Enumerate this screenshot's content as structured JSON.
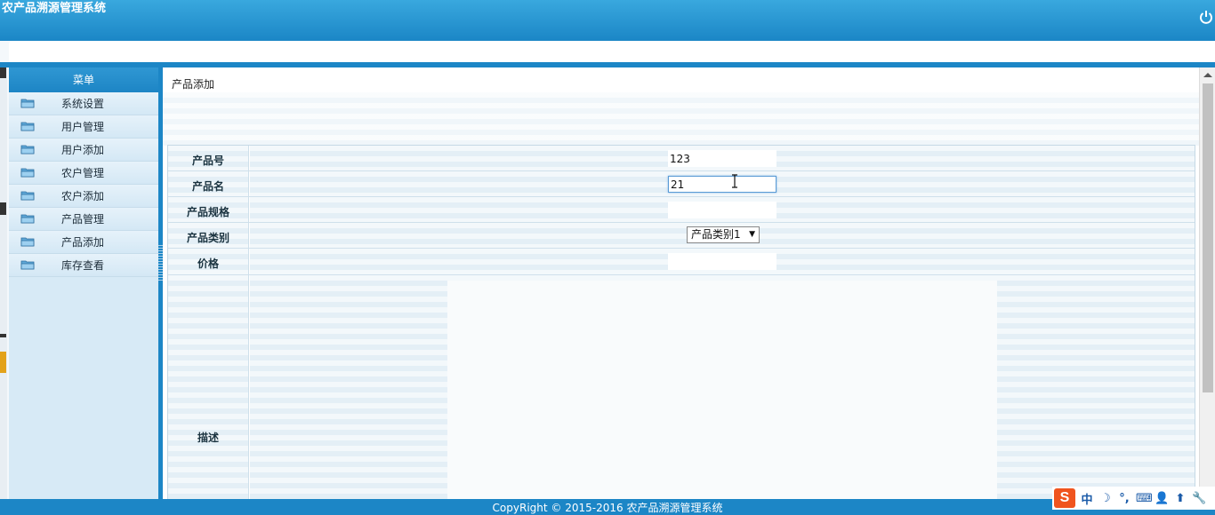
{
  "app": {
    "title": "农产品溯源管理系统"
  },
  "sidebar": {
    "header": "菜单",
    "items": [
      {
        "label": "系统设置"
      },
      {
        "label": "用户管理"
      },
      {
        "label": "用户添加"
      },
      {
        "label": "农户管理"
      },
      {
        "label": "农户添加"
      },
      {
        "label": "产品管理"
      },
      {
        "label": "产品添加"
      },
      {
        "label": "库存查看"
      }
    ]
  },
  "main": {
    "breadcrumb": "产品添加",
    "form": {
      "product_no": {
        "label": "产品号",
        "value": "123"
      },
      "product_name": {
        "label": "产品名",
        "value": "21"
      },
      "product_spec": {
        "label": "产品规格",
        "value": ""
      },
      "product_category": {
        "label": "产品类别",
        "value": "产品类别1"
      },
      "price": {
        "label": "价格",
        "value": ""
      },
      "description": {
        "label": "描述",
        "value": ""
      }
    }
  },
  "footer": {
    "text": "CopyRight © 2015-2016 农产品溯源管理系统"
  },
  "ime": {
    "lang": "中",
    "moon": "☽",
    "punct": "°,",
    "keyboard": "⌨",
    "user": "👤",
    "up": "⬆",
    "tool": "🔧"
  },
  "colors": {
    "primary": "#1c86c6",
    "header_top": "#39a8de",
    "sidebar_bg": "#d7eaf6",
    "ime_logo": "#f0541e"
  }
}
